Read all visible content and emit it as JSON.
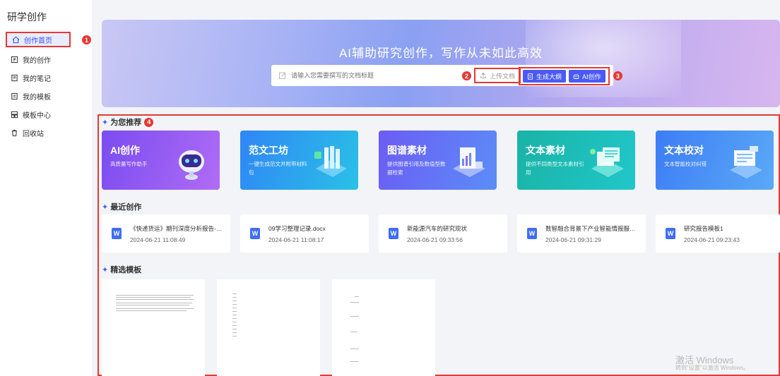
{
  "app": {
    "title": "研学创作"
  },
  "sidebar": {
    "items": [
      {
        "label": "创作首页",
        "icon": "home-icon"
      },
      {
        "label": "我的创作",
        "icon": "book-icon"
      },
      {
        "label": "我的笔记",
        "icon": "note-icon"
      },
      {
        "label": "我的模板",
        "icon": "template-icon"
      },
      {
        "label": "模板中心",
        "icon": "grid-icon"
      },
      {
        "label": "回收站",
        "icon": "trash-icon"
      }
    ]
  },
  "badges": [
    "1",
    "2",
    "3",
    "4"
  ],
  "hero": {
    "title": "AI辅助研究创作，写作从未如此高效",
    "search_placeholder": "请输入您需要撰写的文档标题",
    "upload_label": "上传文档",
    "outline_label": "生成大纲",
    "ai_create_label": "AI创作"
  },
  "recommend": {
    "title": "为您推荐",
    "cards": [
      {
        "title": "AI创作",
        "desc": "高质量写作助手",
        "color1": "#7a4cf0",
        "color2": "#b06cf5"
      },
      {
        "title": "范文工坊",
        "desc": "一键生成范文并附带材料包",
        "color1": "#2f86f6",
        "color2": "#2ac1e6"
      },
      {
        "title": "图谱素材",
        "desc": "提供图谱引用及数值型数据检索",
        "color1": "#6b5cf5",
        "color2": "#5c8df6"
      },
      {
        "title": "文本素材",
        "desc": "提供不同类型文本素材引用",
        "color1": "#19b3a6",
        "color2": "#21c7c9"
      },
      {
        "title": "文本校对",
        "desc": "文本智能校对纠错",
        "color1": "#3d7df5",
        "color2": "#5aa9f7"
      }
    ]
  },
  "recent": {
    "title": "最近创作",
    "docs": [
      {
        "name": "《快递货运》期刊深度分析报告-标准...",
        "time": "2024-06-21 11:08:49"
      },
      {
        "name": "09学习整理记录.docx",
        "time": "2024-06-21 11:08:17"
      },
      {
        "name": "新能源汽车的研究现状",
        "time": "2024-06-21 09:33:56"
      },
      {
        "name": "数智融合背景下产业智能情报服务的...",
        "time": "2024-06-21 09:31:29"
      },
      {
        "name": "研究报告模板1",
        "time": "2024-06-21 09:23:43"
      }
    ]
  },
  "templates": {
    "title": "精选模板"
  },
  "watermark": {
    "line1": "激活 Windows",
    "line2": "转到\"设置\"以激活 Windows。"
  }
}
